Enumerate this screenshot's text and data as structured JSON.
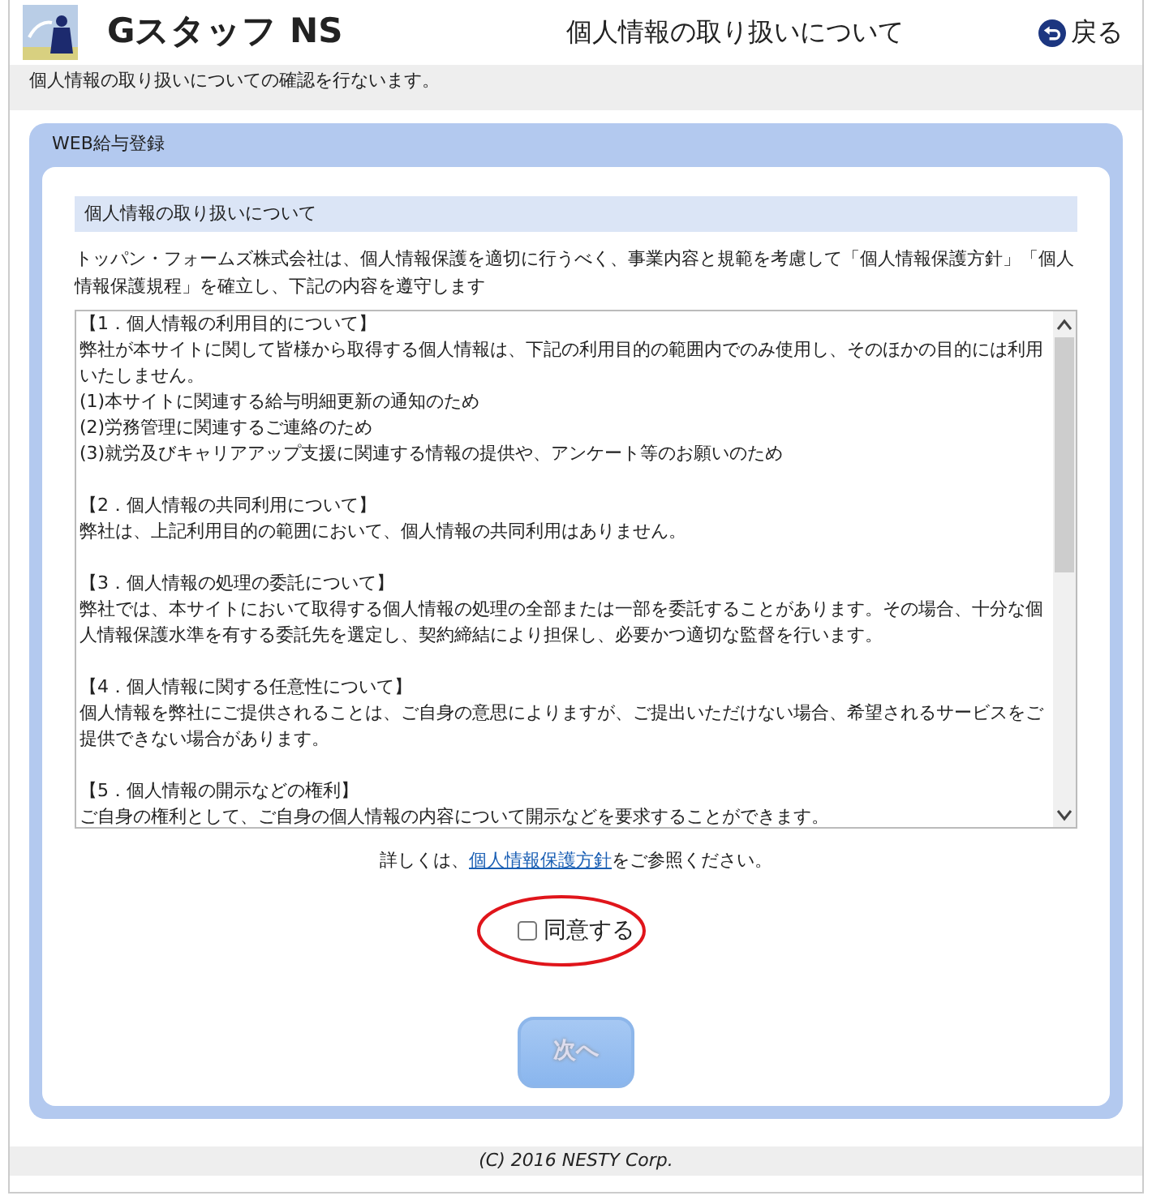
{
  "header": {
    "app_name": "Gスタッフ NS",
    "title": "個人情報の取り扱いについて",
    "back_label": "戻る"
  },
  "notice": "個人情報の取り扱いについての確認を行ないます。",
  "panel": {
    "title": "WEB給与登録",
    "section_title": "個人情報の取り扱いについて",
    "intro": "トッパン・フォームズ株式会社は、個人情報保護を適切に行うべく、事業内容と規範を考慮して「個人情報保護方針」「個人情報保護規程」を確立し、下記の内容を遵守します",
    "terms": [
      {
        "heading": "【1．個人情報の利用目的について】",
        "lines": [
          "弊社が本サイトに関して皆様から取得する個人情報は、下記の利用目的の範囲内でのみ使用し、そのほかの目的には利用いたしません。",
          "(1)本サイトに関連する給与明細更新の通知のため",
          "(2)労務管理に関連するご連絡のため",
          "(3)就労及びキャリアアップ支援に関連する情報の提供や、アンケート等のお願いのため"
        ]
      },
      {
        "heading": "【2．個人情報の共同利用について】",
        "lines": [
          "弊社は、上記利用目的の範囲において、個人情報の共同利用はありません。"
        ]
      },
      {
        "heading": "【3．個人情報の処理の委託について】",
        "lines": [
          "弊社では、本サイトにおいて取得する個人情報の処理の全部または一部を委託することがあります。その場合、十分な個人情報保護水準を有する委託先を選定し、契約締結により担保し、必要かつ適切な監督を行います。"
        ]
      },
      {
        "heading": "【4．個人情報に関する任意性について】",
        "lines": [
          "個人情報を弊社にご提供されることは、ご自身の意思によりますが、ご提出いただけない場合、希望されるサービスをご提供できない場合があります。"
        ]
      },
      {
        "heading": "【5．個人情報の開示などの権利】",
        "lines": [
          "ご自身の権利として、ご自身の個人情報の内容について開示などを要求することができます。"
        ]
      }
    ],
    "details_before": "詳しくは、",
    "details_link": "個人情報保護方針",
    "details_after": "をご参照ください。",
    "agree": {
      "label": "同意する",
      "checked": false
    },
    "next_button": {
      "label": "次へ",
      "disabled": true
    }
  },
  "footer": "(C) 2016 NESTY Corp."
}
